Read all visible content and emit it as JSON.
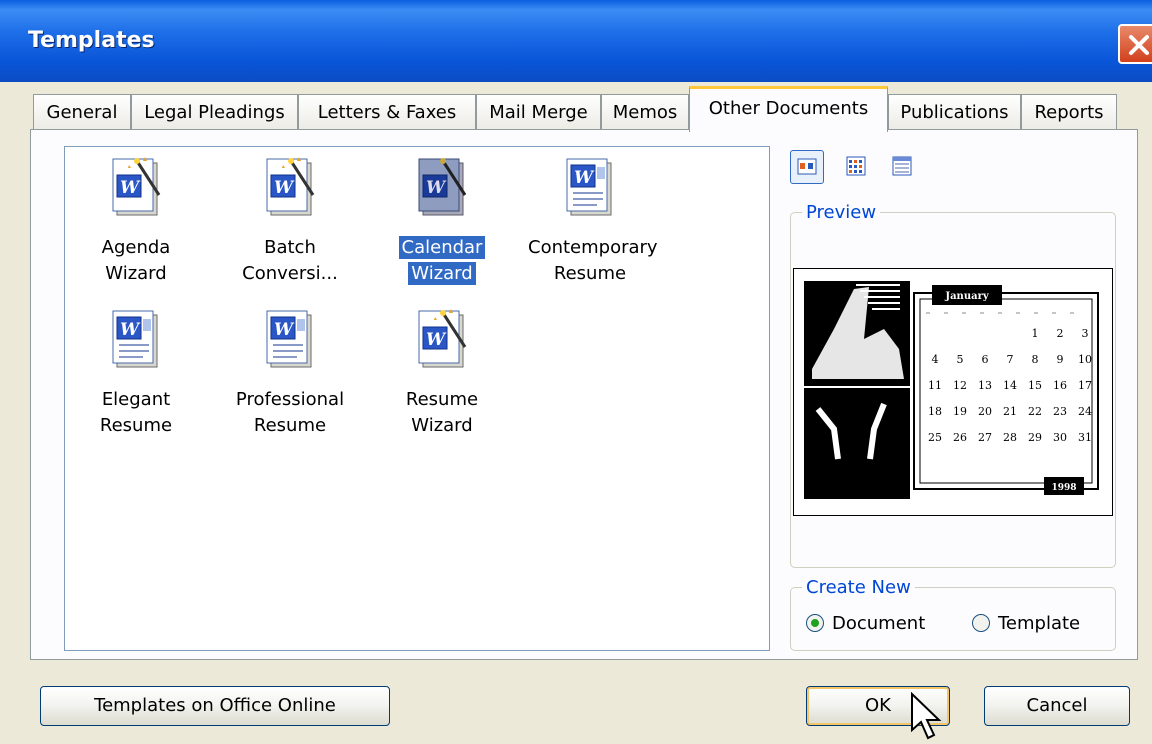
{
  "window": {
    "title": "Templates"
  },
  "tabs": [
    {
      "label": "General"
    },
    {
      "label": "Legal Pleadings"
    },
    {
      "label": "Letters & Faxes"
    },
    {
      "label": "Mail Merge"
    },
    {
      "label": "Memos"
    },
    {
      "label": "Other Documents",
      "active": true
    },
    {
      "label": "Publications"
    },
    {
      "label": "Reports"
    }
  ],
  "templates": [
    {
      "line1": "Agenda",
      "line2": "Wizard",
      "icon": "wizard-doc-icon"
    },
    {
      "line1": "Batch",
      "line2": "Conversi...",
      "icon": "wizard-doc-icon"
    },
    {
      "line1": "Calendar",
      "line2": "Wizard",
      "icon": "wizard-doc-icon",
      "selected": true
    },
    {
      "line1": "Contemporary",
      "line2": "Resume",
      "icon": "word-doc-icon"
    },
    {
      "line1": "Elegant",
      "line2": "Resume",
      "icon": "word-doc-icon"
    },
    {
      "line1": "Professional",
      "line2": "Resume",
      "icon": "word-doc-icon"
    },
    {
      "line1": "Resume",
      "line2": "Wizard",
      "icon": "wizard-doc-icon"
    }
  ],
  "view_buttons": [
    "large-icons-view-icon",
    "list-view-icon",
    "details-view-icon"
  ],
  "preview": {
    "label": "Preview",
    "calendar_month": "January",
    "calendar_year": "1998",
    "calendar_days": [
      "1",
      "2",
      "3",
      "4",
      "5",
      "6",
      "7",
      "8",
      "9",
      "10",
      "11",
      "12",
      "13",
      "14",
      "15",
      "16",
      "17",
      "18",
      "19",
      "20",
      "21",
      "22",
      "23",
      "24",
      "25",
      "26",
      "27",
      "28",
      "29",
      "30",
      "31"
    ]
  },
  "create_new": {
    "label": "Create New",
    "options": [
      {
        "label": "Document",
        "selected": true
      },
      {
        "label": "Template",
        "selected": false
      }
    ]
  },
  "buttons": {
    "online": "Templates on Office Online",
    "ok": "OK",
    "cancel": "Cancel"
  },
  "colors": {
    "titlebar": "#0a5ee0",
    "selection": "#316ac5",
    "group_label": "#0046d5",
    "tab_highlight": "#ffc83c"
  }
}
